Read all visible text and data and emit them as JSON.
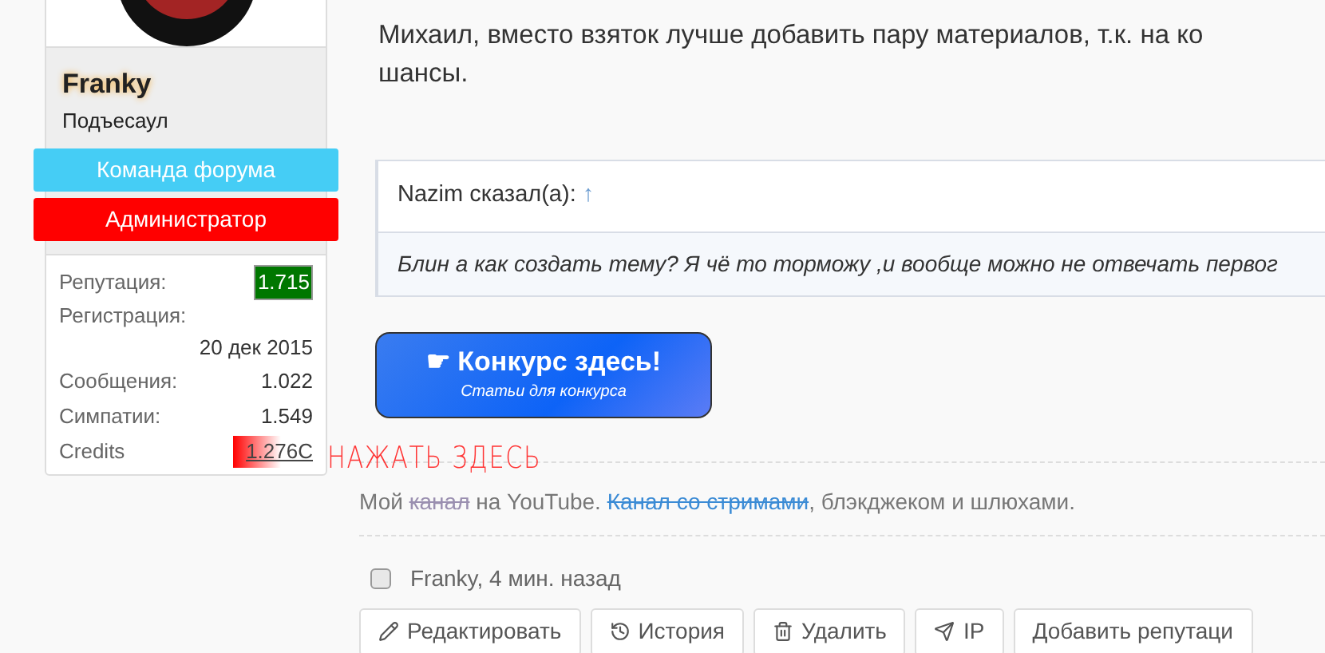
{
  "user": {
    "name": "Franky",
    "title": "Подъесаул",
    "banners": [
      {
        "label": "Команда форума",
        "kind": "team"
      },
      {
        "label": "Администратор",
        "kind": "admin"
      }
    ],
    "stats": [
      {
        "label": "Репутация:",
        "value": "1.715",
        "kind": "reputation"
      },
      {
        "label": "Регистрация:",
        "value": "20 дек 2015",
        "kind": "wrapped"
      },
      {
        "label": "Сообщения:",
        "value": "1.022",
        "kind": "plain"
      },
      {
        "label": "Симпатии:",
        "value": "1.549",
        "kind": "plain"
      },
      {
        "label": "Credits",
        "value": "1.276C",
        "kind": "credits"
      }
    ],
    "credits_hint": "НАЖАТЬ ЗДЕСЬ"
  },
  "post": {
    "lines": [
      "Михаил, вместо взяток лучше добавить пару материалов, т.к. на ко",
      "шансы."
    ],
    "quote": {
      "author": "Nazim сказал(а):",
      "arrow": "↑",
      "text": "Блин а как создать тему? Я чё то торможу ,и вообще можно не отвечать первог"
    },
    "banner": {
      "title": "☛ Конкурс здесь!",
      "subtitle": "Статьи для конкурса"
    },
    "signature": [
      {
        "text": "Мой ",
        "kind": "plain"
      },
      {
        "text": "канал",
        "kind": "strike"
      },
      {
        "text": " на YouTube. ",
        "kind": "plain"
      },
      {
        "text": "Канал со стримами",
        "kind": "link"
      },
      {
        "text": ", блэкджеком и шлюхами.",
        "kind": "plain"
      }
    ],
    "meta": {
      "checked": false,
      "text": "Franky, 4 мин. назад"
    },
    "actions": [
      {
        "label": "Редактировать",
        "kind": "edit"
      },
      {
        "label": "История",
        "kind": "history"
      },
      {
        "label": "Удалить",
        "kind": "delete"
      },
      {
        "label": "IP",
        "kind": "ip"
      },
      {
        "label": "Добавить репутаци",
        "kind": "plain"
      }
    ]
  }
}
